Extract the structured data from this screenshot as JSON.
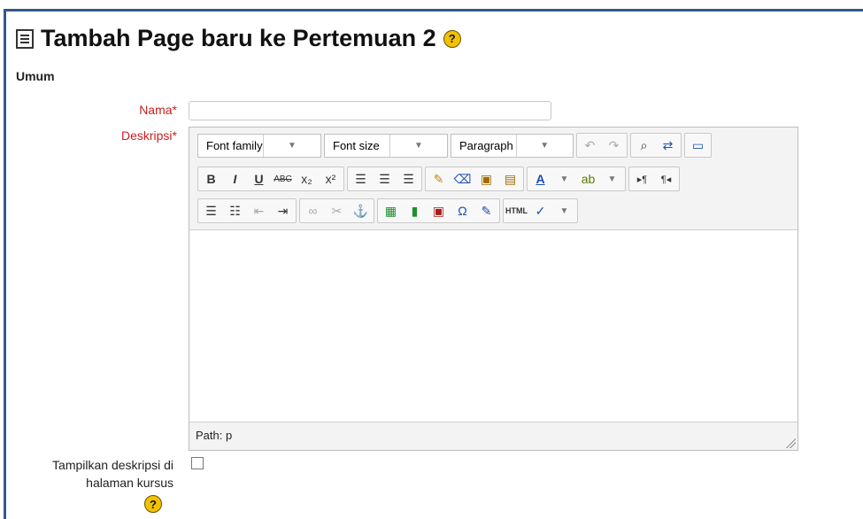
{
  "header": {
    "title": "Tambah Page baru ke Pertemuan 2",
    "help_icon": "help-icon"
  },
  "section": {
    "title": "Umum"
  },
  "fields": {
    "nama_label": "Nama",
    "deskripsi_label": "Deskripsi",
    "required_marker": "*"
  },
  "editor": {
    "font_family": "Font family",
    "font_size": "Font size",
    "paragraph": "Paragraph",
    "path": "Path: p",
    "icons": [
      "undo-icon",
      "redo-icon",
      "search-icon",
      "replace-icon",
      "fullscreen-icon",
      "bold-icon",
      "italic-icon",
      "underline-icon",
      "strikethrough-icon",
      "subscript-icon",
      "superscript-icon",
      "align-left-icon",
      "align-center-icon",
      "align-right-icon",
      "cleanup-icon",
      "eraser-icon",
      "paste-text-icon",
      "paste-word-icon",
      "text-color-icon",
      "highlight-icon",
      "ltr-icon",
      "rtl-icon",
      "bullet-list-icon",
      "numbered-list-icon",
      "outdent-icon",
      "indent-icon",
      "link-icon",
      "unlink-icon",
      "anchor-icon",
      "image-icon",
      "media-icon",
      "embed-icon",
      "special-char-icon",
      "edit-icon",
      "html-icon",
      "spellcheck-icon"
    ]
  },
  "options": {
    "show_description": "Tampilkan deskripsi di halaman kursus"
  },
  "colors": {
    "frame": "#35588a",
    "required": "#cc1e1e",
    "help": "#f2c200"
  }
}
